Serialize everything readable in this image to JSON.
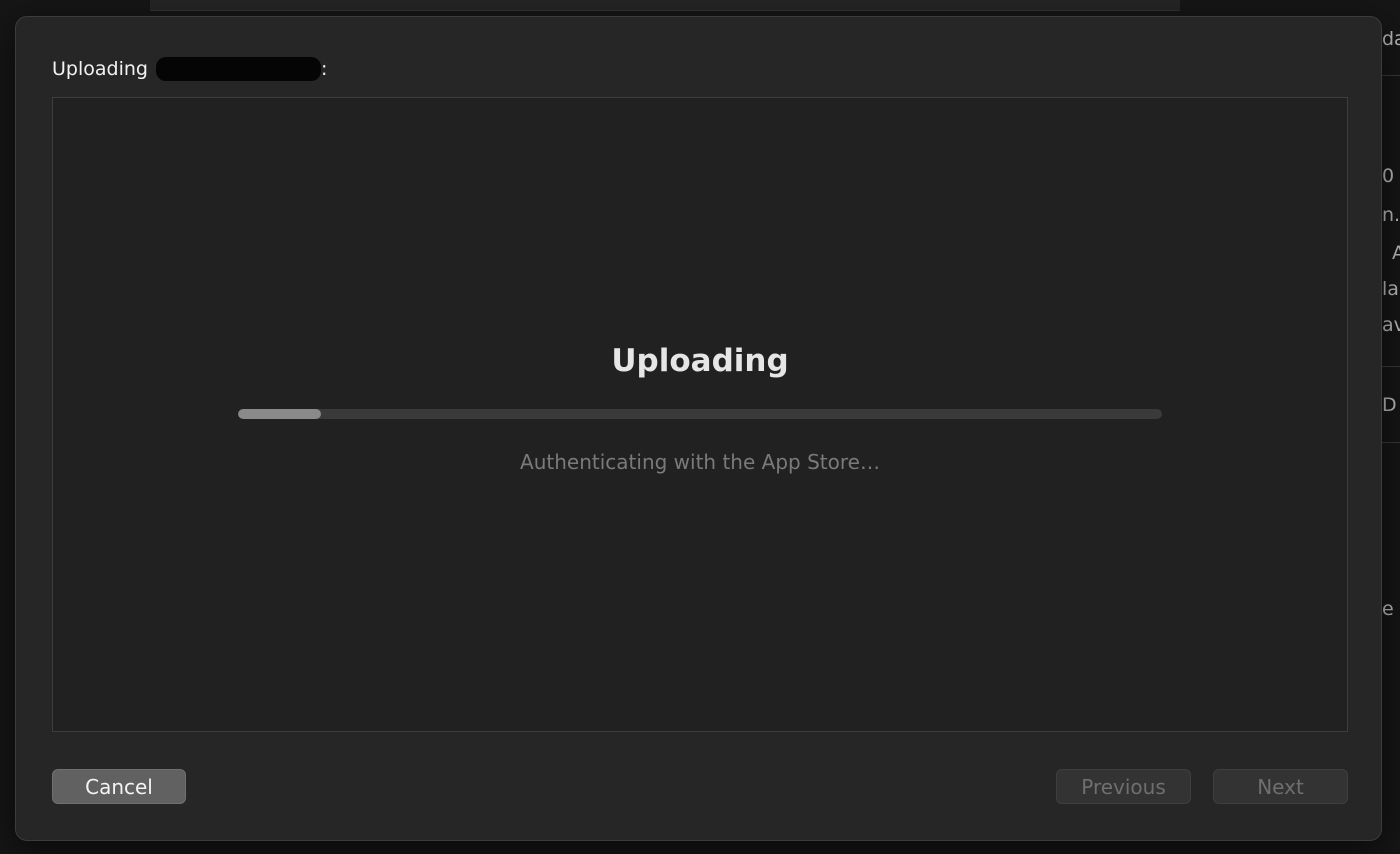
{
  "dialog": {
    "title_prefix": "Uploading",
    "title_suffix": ":"
  },
  "status": {
    "heading": "Uploading",
    "detail": "Authenticating with the App Store…",
    "progress": 0.09
  },
  "buttons": {
    "cancel": "Cancel",
    "previous": "Previous",
    "next": "Next"
  },
  "background_fragments": [
    "da",
    "0",
    "n.",
    "A",
    "la",
    "av",
    "D",
    "e"
  ]
}
